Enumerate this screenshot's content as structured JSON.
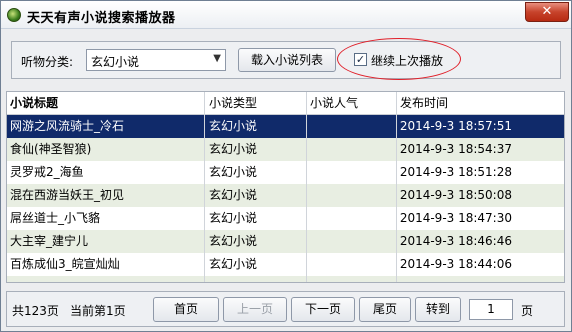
{
  "window": {
    "title": "天天有声小说搜索播放器",
    "close_label": "✕"
  },
  "toolbar": {
    "category_label": "听物分类:",
    "category_value": "玄幻小说",
    "load_button": "载入小说列表",
    "continue_checkbox": {
      "label": "继续上次播放",
      "checked": true,
      "check_glyph": "✓"
    }
  },
  "table": {
    "columns": [
      "小说标题",
      "小说类型",
      "小说人气",
      "发布时间"
    ],
    "rows": [
      {
        "title": "网游之风流骑士_冷石",
        "type": "玄幻小说",
        "popularity": "",
        "time": "2014-9-3 18:57:51",
        "selected": true
      },
      {
        "title": "食仙(神圣智狼)",
        "type": "玄幻小说",
        "popularity": "",
        "time": "2014-9-3 18:54:37",
        "selected": false
      },
      {
        "title": "灵罗戒2_海鱼",
        "type": "玄幻小说",
        "popularity": "",
        "time": "2014-9-3 18:51:28",
        "selected": false
      },
      {
        "title": "混在西游当妖王_初见",
        "type": "玄幻小说",
        "popularity": "",
        "time": "2014-9-3 18:50:08",
        "selected": false
      },
      {
        "title": "屌丝道士_小飞貉",
        "type": "玄幻小说",
        "popularity": "",
        "time": "2014-9-3 18:47:30",
        "selected": false
      },
      {
        "title": "大主宰_建宁儿",
        "type": "玄幻小说",
        "popularity": "",
        "time": "2014-9-3 18:46:46",
        "selected": false
      },
      {
        "title": "百炼成仙3_皖宣灿灿",
        "type": "玄幻小说",
        "popularity": "",
        "time": "2014-9-3 18:44:06",
        "selected": false
      },
      {
        "title": "",
        "type": "",
        "popularity": "",
        "time": "",
        "selected": false
      }
    ]
  },
  "pager": {
    "total": "共123页",
    "current": "当前第1页",
    "first": "首页",
    "prev": "上一页",
    "next": "下一页",
    "last": "尾页",
    "goto": "转到",
    "page_input": "1",
    "unit": "页"
  },
  "colors": {
    "selected_row": "#102a6a",
    "alt_row": "#e8eee2",
    "annotation": "#e0202a"
  }
}
